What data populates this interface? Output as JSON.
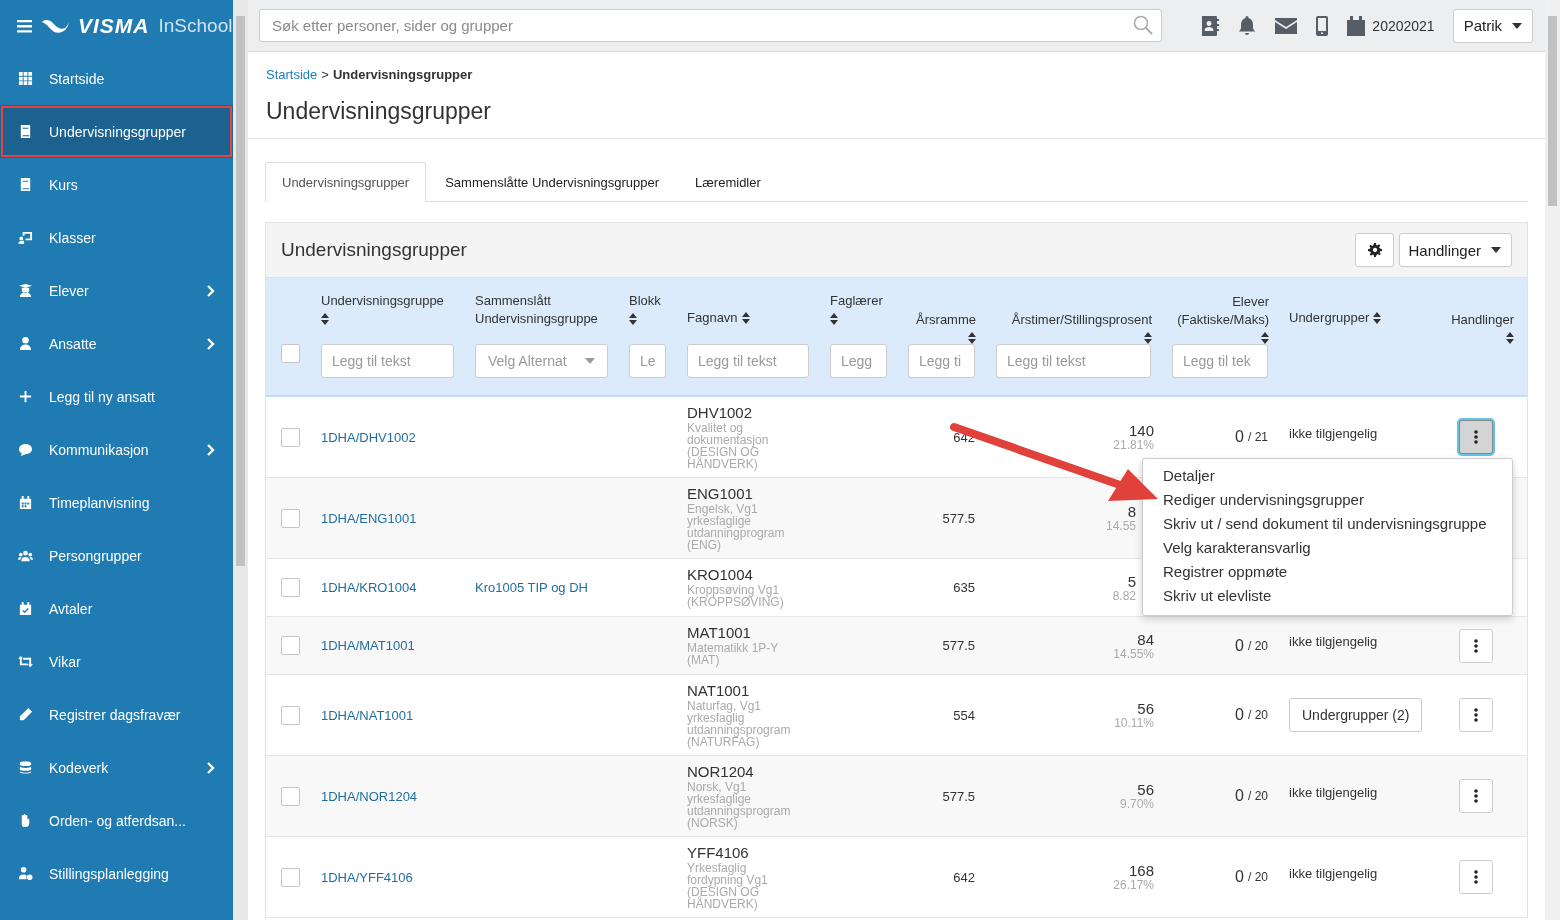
{
  "logo": {
    "brand": "VISMA",
    "product": "InSchool"
  },
  "sidebar": {
    "items": [
      {
        "label": "Startside",
        "selected": false,
        "expandable": false
      },
      {
        "label": "Undervisningsgrupper",
        "selected": true,
        "expandable": false
      },
      {
        "label": "Kurs",
        "selected": false,
        "expandable": false
      },
      {
        "label": "Klasser",
        "selected": false,
        "expandable": false
      },
      {
        "label": "Elever",
        "selected": false,
        "expandable": true
      },
      {
        "label": "Ansatte",
        "selected": false,
        "expandable": true
      },
      {
        "label": "Legg til ny ansatt",
        "selected": false,
        "expandable": false
      },
      {
        "label": "Kommunikasjon",
        "selected": false,
        "expandable": true
      },
      {
        "label": "Timeplanvisning",
        "selected": false,
        "expandable": false
      },
      {
        "label": "Persongrupper",
        "selected": false,
        "expandable": false
      },
      {
        "label": "Avtaler",
        "selected": false,
        "expandable": false
      },
      {
        "label": "Vikar",
        "selected": false,
        "expandable": false
      },
      {
        "label": "Registrer dagsfravær",
        "selected": false,
        "expandable": false
      },
      {
        "label": "Kodeverk",
        "selected": false,
        "expandable": true
      },
      {
        "label": "Orden- og atferdsan...",
        "selected": false,
        "expandable": false
      },
      {
        "label": "Stillingsplanlegging",
        "selected": false,
        "expandable": false
      }
    ]
  },
  "topbar": {
    "search": {
      "placeholder": "Søk etter personer, sider og grupper"
    },
    "school_year": "20202021",
    "user": "Patrik"
  },
  "breadcrumb": {
    "items": [
      "Startside",
      "Undervisningsgrupper"
    ],
    "separator": ">"
  },
  "page_title": "Undervisningsgrupper",
  "tabs": [
    {
      "label": "Undervisningsgrupper",
      "selected": true
    },
    {
      "label": "Sammenslåtte Undervisningsgrupper",
      "selected": false
    },
    {
      "label": "Læremidler",
      "selected": false
    }
  ],
  "panel": {
    "title": "Undervisningsgrupper",
    "actions_button": "Handlinger"
  },
  "table": {
    "select_all_checked": false,
    "columns": [
      {
        "label": "Undervisningsgruppe",
        "sortable": true
      },
      {
        "label": "Sammenslått Undervisningsgruppe",
        "sortable": false
      },
      {
        "label": "Blokk",
        "sortable": true
      },
      {
        "label": "Fagnavn",
        "sortable": true
      },
      {
        "label": "Faglærer",
        "sortable": true
      },
      {
        "label": "Årsramme",
        "sortable": true
      },
      {
        "label": "Årstimer/Stillingsprosent",
        "sortable": true
      },
      {
        "label": "Elever (Faktiske/Maks)",
        "sortable": true
      },
      {
        "label": "Undergrupper",
        "sortable": true
      },
      {
        "label": "Handlinger",
        "sortable": true
      }
    ],
    "filters": [
      {
        "kind": "text",
        "placeholder": "Legg til tekst"
      },
      {
        "kind": "select",
        "placeholder": "Velg Alternat"
      },
      {
        "kind": "text",
        "placeholder": "Le"
      },
      {
        "kind": "text",
        "placeholder": "Legg til tekst"
      },
      {
        "kind": "text",
        "placeholder": "Legg"
      },
      {
        "kind": "text",
        "placeholder": "Legg ti"
      },
      {
        "kind": "text",
        "placeholder": "Legg til tekst"
      },
      {
        "kind": "text",
        "placeholder": "Legg til tek"
      }
    ],
    "rows": [
      {
        "checked": false,
        "group": "1DHA/DHV1002",
        "subject_code": "DHV1002",
        "subject_name": "Kvalitet og dokumentasjon (DESIGN OG HÅNDVERK)",
        "year_frame": "642",
        "hours": "140",
        "percent": "21.81%",
        "students": "0",
        "max": "/ 21",
        "subgroups": {
          "kind": "text",
          "text": "ikke tilgjengelig"
        },
        "menu_button": {
          "active": true
        }
      },
      {
        "checked": false,
        "group": "1DHA/ENG1001",
        "subject_code": "ENG1001",
        "subject_name": "Engelsk, Vg1 yrkesfaglige utdanningprogram (ENG)",
        "year_frame": "577.5",
        "hours": "8",
        "percent": "14.55"
      },
      {
        "checked": false,
        "group": "1DHA/KRO1004",
        "merged": "Kro1005 TIP og DH",
        "subject_code": "KRO1004",
        "subject_name": "Kroppsøving Vg1 (KROPPSØVING)",
        "year_frame": "635",
        "hours": "5",
        "percent": "8.82"
      },
      {
        "checked": false,
        "group": "1DHA/MAT1001",
        "subject_code": "MAT1001",
        "subject_name": "Matematikk 1P-Y (MAT)",
        "year_frame": "577.5",
        "hours": "84",
        "percent": "14.55%",
        "students": "0",
        "max": "/ 20",
        "subgroups": {
          "kind": "text",
          "text": "ikke tilgjengelig"
        },
        "menu_button": {
          "active": false
        }
      },
      {
        "checked": false,
        "group": "1DHA/NAT1001",
        "subject_code": "NAT1001",
        "subject_name": "Naturfag, Vg1 yrkesfaglig utdanningsprogram (NATURFAG)",
        "year_frame": "554",
        "hours": "56",
        "percent": "10.11%",
        "students": "0",
        "max": "/ 20",
        "subgroups": {
          "kind": "button",
          "text": "Undergrupper (2)"
        },
        "menu_button": {
          "active": false
        }
      },
      {
        "checked": false,
        "group": "1DHA/NOR1204",
        "subject_code": "NOR1204",
        "subject_name": "Norsk, Vg1 yrkesfaglige utdanningsprogram (NORSK)",
        "year_frame": "577.5",
        "hours": "56",
        "percent": "9.70%",
        "students": "0",
        "max": "/ 20",
        "subgroups": {
          "kind": "text",
          "text": "ikke tilgjengelig"
        },
        "menu_button": {
          "active": false
        }
      },
      {
        "checked": false,
        "group": "1DHA/YFF4106",
        "subject_code": "YFF4106",
        "subject_name": "Yrkesfaglig fordypning Vg1 (DESIGN OG HÅNDVERK)",
        "year_frame": "642",
        "hours": "168",
        "percent": "26.17%",
        "students": "0",
        "max": "/ 20",
        "subgroups": {
          "kind": "text",
          "text": "ikke tilgjengelig"
        },
        "menu_button": {
          "active": false
        }
      }
    ]
  },
  "action_menu": {
    "items": [
      "Detaljer",
      "Rediger undervisningsgrupper",
      "Skriv ut / send dokument til undervisningsgruppe",
      "Velg karakteransvarlig",
      "Registrer oppmøte",
      "Skriv ut elevliste"
    ]
  }
}
